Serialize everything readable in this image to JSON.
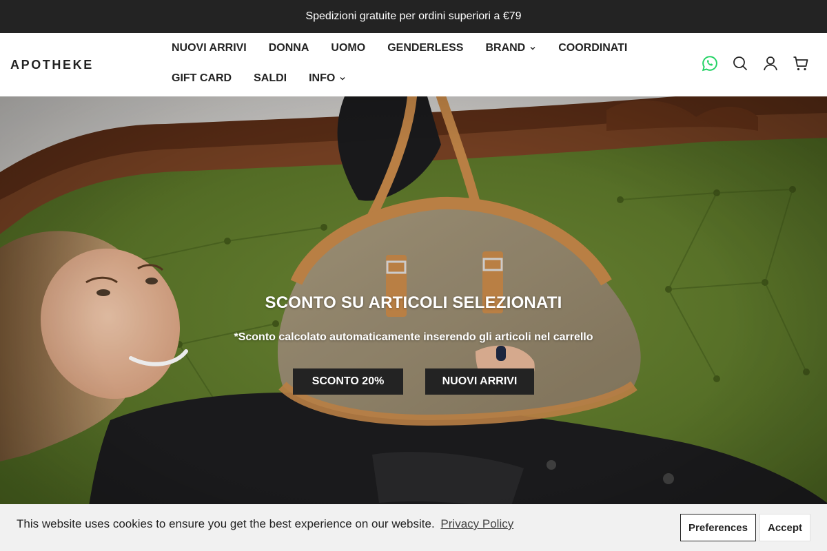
{
  "announcement": {
    "text": "Spedizioni gratuite per ordini superiori a €79"
  },
  "header": {
    "logo": "APOTHEKE",
    "nav_row1": [
      {
        "label": "NUOVI ARRIVI",
        "dropdown": false
      },
      {
        "label": "DONNA",
        "dropdown": false
      },
      {
        "label": "UOMO",
        "dropdown": false
      },
      {
        "label": "GENDERLESS",
        "dropdown": false
      },
      {
        "label": "BRAND",
        "dropdown": true
      },
      {
        "label": "COORDINATI",
        "dropdown": false
      }
    ],
    "nav_row2": [
      {
        "label": "GIFT CARD",
        "dropdown": false
      },
      {
        "label": "SALDI",
        "dropdown": false
      },
      {
        "label": "INFO",
        "dropdown": true
      }
    ],
    "icons": [
      "whatsapp-icon",
      "search-icon",
      "account-icon",
      "cart-icon"
    ],
    "whatsapp_color": "#25D366"
  },
  "hero": {
    "title": "SCONTO SU ARTICOLI SELEZIONATI",
    "subtitle": "*Sconto calcolato automaticamente inserendo gli articoli nel carrello",
    "buttons": [
      "SCONTO 20%",
      "NUOVI ARRIVI"
    ]
  },
  "cookie": {
    "text": "This website uses cookies to ensure you get the best experience on our website.",
    "link": "Privacy Policy",
    "preferences": "Preferences",
    "accept": "Accept"
  },
  "colors": {
    "dark": "#232323",
    "sofa_green": "#5e7a2c",
    "wood": "#6b3a1f",
    "leather": "#c98a4a"
  }
}
